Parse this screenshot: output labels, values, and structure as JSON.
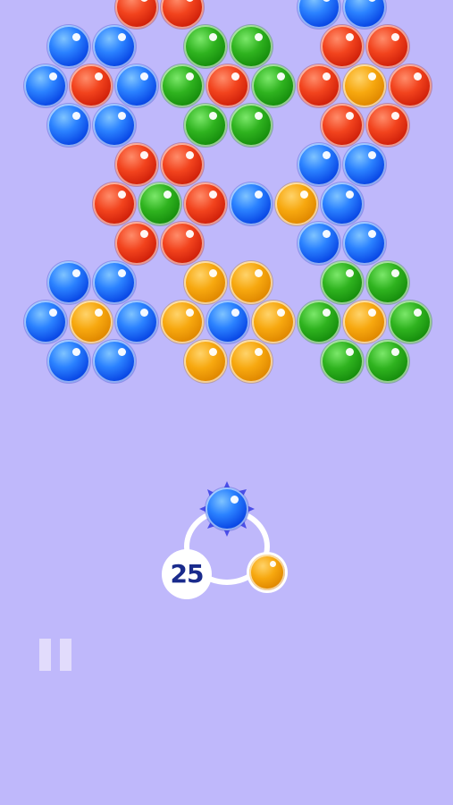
{
  "hud": {
    "shots_remaining": "25"
  },
  "shooter": {
    "current_color": "blue",
    "next_color": "orange"
  },
  "icons": {
    "pause": "pause-icon"
  },
  "colors": {
    "background": "#bfb8fb",
    "blue": "#1f6bff",
    "red": "#e8361a",
    "green": "#25a11a",
    "orange": "#f2a10c",
    "counter_text": "#1a2b8c"
  },
  "grid": {
    "rows": [
      [
        "",
        "",
        "red",
        "red",
        "",
        "",
        "blue",
        "blue",
        ""
      ],
      [
        "blue",
        "blue",
        "",
        "green",
        "green",
        "",
        "red",
        "red"
      ],
      [
        "blue",
        "red",
        "blue",
        "green",
        "red",
        "green",
        "red",
        "orange",
        "red"
      ],
      [
        "blue",
        "blue",
        "",
        "green",
        "green",
        "",
        "red",
        "red"
      ],
      [
        "",
        "",
        "red",
        "red",
        "",
        "",
        "blue",
        "blue",
        ""
      ],
      [
        "",
        "red",
        "green",
        "red",
        "blue",
        "orange",
        "blue",
        ""
      ],
      [
        "",
        "",
        "red",
        "red",
        "",
        "",
        "blue",
        "blue",
        ""
      ],
      [
        "blue",
        "blue",
        "",
        "orange",
        "orange",
        "",
        "green",
        "green"
      ],
      [
        "blue",
        "orange",
        "blue",
        "orange",
        "blue",
        "orange",
        "green",
        "orange",
        "green"
      ],
      [
        "blue",
        "blue",
        "",
        "orange",
        "orange",
        "",
        "green",
        "green"
      ]
    ]
  }
}
